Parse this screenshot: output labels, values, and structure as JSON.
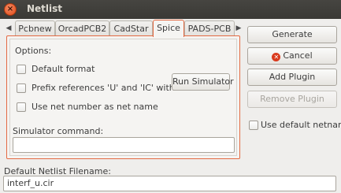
{
  "window": {
    "title": "Netlist",
    "close_glyph": "×"
  },
  "tabs": {
    "left_arrow": "◀",
    "right_arrow": "▶",
    "items": [
      {
        "label": "Pcbnew"
      },
      {
        "label": "OrcadPCB2"
      },
      {
        "label": "CadStar"
      },
      {
        "label": "Spice"
      },
      {
        "label": "PADS-PCB"
      }
    ],
    "active_index": 3
  },
  "options": {
    "heading": "Options:",
    "default_format": "Default format",
    "prefix_references": "Prefix references 'U' and 'IC' with 'X'",
    "use_net_number": "Use net number as net name",
    "run_simulator": "Run Simulator"
  },
  "simulator": {
    "label": "Simulator command:",
    "value": ""
  },
  "buttons": {
    "generate": "Generate",
    "cancel": "Cancel",
    "add_plugin": "Add Plugin",
    "remove_plugin": "Remove Plugin"
  },
  "use_default_netname": "Use default netname",
  "filename": {
    "label": "Default Netlist Filename:",
    "value": "interf_u.cir"
  },
  "colors": {
    "accent": "#e46a43",
    "titlebar": "#3c3b37"
  }
}
